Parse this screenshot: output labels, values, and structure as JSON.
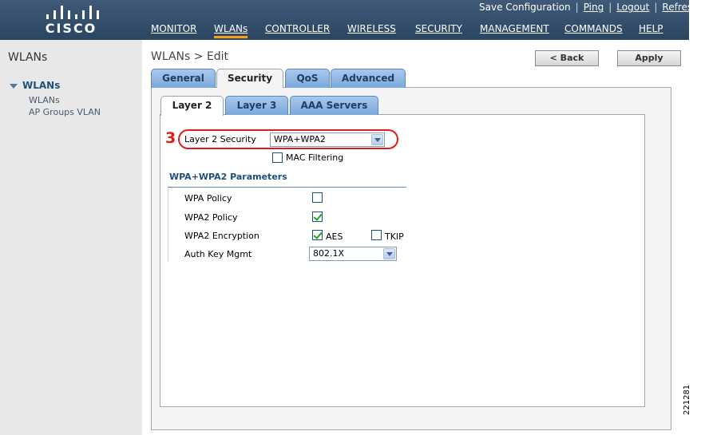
{
  "header": {
    "logo_text": "CISCO",
    "utility_links": [
      "Save Configuration",
      "Ping",
      "Logout",
      "Refresh"
    ],
    "nav": [
      "MONITOR",
      "WLANs",
      "CONTROLLER",
      "WIRELESS",
      "SECURITY",
      "MANAGEMENT",
      "COMMANDS",
      "HELP"
    ],
    "active_nav": "WLANs"
  },
  "sidebar": {
    "title": "WLANs",
    "tree_head": "WLANs",
    "items": [
      "WLANs",
      "AP Groups VLAN"
    ]
  },
  "page": {
    "title": "WLANs > Edit",
    "back_label": "< Back",
    "apply_label": "Apply",
    "tabs": [
      "General",
      "Security",
      "QoS",
      "Advanced"
    ],
    "active_tab": "Security",
    "subtabs": [
      "Layer 2",
      "Layer 3",
      "AAA Servers"
    ],
    "active_subtab": "Layer 2"
  },
  "layer2": {
    "callout_number": "3",
    "security_label": "Layer 2 Security",
    "security_value": "WPA+WPA2",
    "mac_filtering_label": "MAC Filtering",
    "mac_filtering_checked": false
  },
  "wpa": {
    "section_title": "WPA+WPA2 Parameters",
    "wpa_policy_label": "WPA Policy",
    "wpa_policy_checked": false,
    "wpa2_policy_label": "WPA2 Policy",
    "wpa2_policy_checked": true,
    "wpa2_encryption_label": "WPA2 Encryption",
    "aes_label": "AES",
    "aes_checked": true,
    "tkip_label": "TKIP",
    "tkip_checked": false,
    "auth_key_label": "Auth Key Mgmt",
    "auth_key_value": "802.1X"
  },
  "figure_number": "221281"
}
